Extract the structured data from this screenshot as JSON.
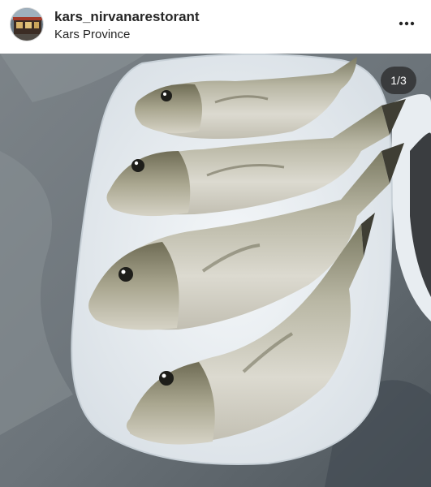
{
  "post": {
    "username": "kars_nirvanarestorant",
    "location": "Kars Province",
    "avatar_icon": "restaurant-avatar",
    "more_icon": "more-options-icon",
    "carousel_counter": "1/3",
    "image_subject": "fresh-fish-on-platter"
  },
  "colors": {
    "text": "#262626",
    "counter_bg": "#262626",
    "background": "#ffffff"
  }
}
